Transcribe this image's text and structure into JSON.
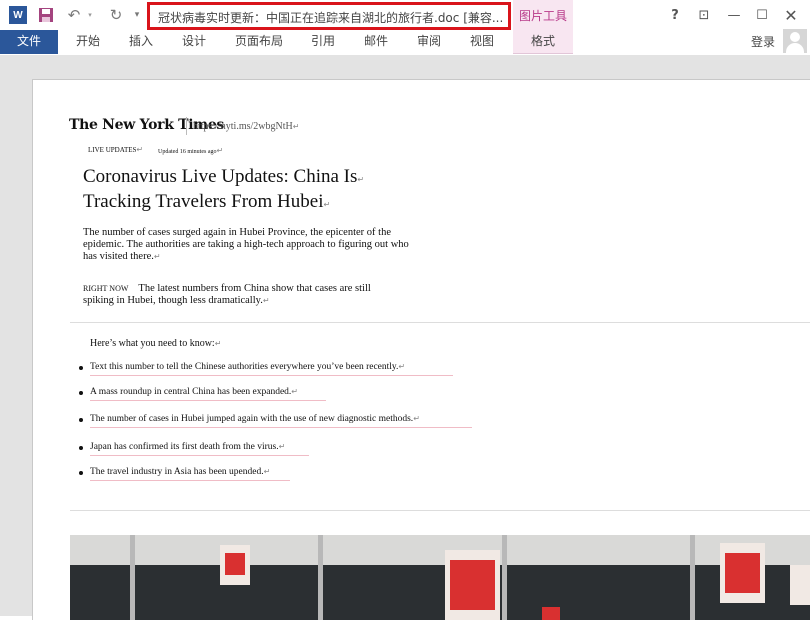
{
  "app": {
    "doc_title": "冠状病毒实时更新：中国正在追踪来自湖北的旅行者.doc [兼容...",
    "contextual_group": "图片工具",
    "word_icon_letter": "W",
    "login": "登录",
    "window_buttons": {
      "help": "?",
      "ribbon_options": "⊡",
      "minimize": "—",
      "maximize": "☐",
      "close": "✕"
    },
    "icons": [
      "word-icon",
      "save-icon",
      "undo-icon",
      "redo-icon",
      "customize-qat-icon",
      "avatar"
    ]
  },
  "ribbon": {
    "tabs": [
      {
        "label": "文件"
      },
      {
        "label": "开始"
      },
      {
        "label": "插入"
      },
      {
        "label": "设计"
      },
      {
        "label": "页面布局"
      },
      {
        "label": "引用"
      },
      {
        "label": "邮件"
      },
      {
        "label": "审阅"
      },
      {
        "label": "视图"
      },
      {
        "label": "格式"
      }
    ]
  },
  "document": {
    "masthead": "The New York Times",
    "short_link": "https://nyti.ms/2wbgNtH",
    "live_updates": "LIVE UPDATES",
    "updated": "Updated 16 minutes ago",
    "headline_line1": "Coronavirus Live Updates: China Is",
    "headline_line2": "Tracking Travelers From Hubei",
    "summary": "The number of cases surged again in Hubei Province, the epicenter of the epidemic. The authorities are taking a high-tech approach to figuring out who has visited there.",
    "right_now_label": "RIGHT NOW",
    "right_now_text": "The latest numbers from China show that cases are still spiking in Hubei, though less dramatically.",
    "intro": "Here’s what you need to know:",
    "bullets": [
      "Text this number to tell the Chinese authorities everywhere you’ve been recently.",
      "A mass roundup in central China has been expanded.",
      "The number of cases in Hubei jumped again with the use of new diagnostic methods.",
      "Japan has confirmed its first death from the virus.",
      "The travel industry in Asia has been upended."
    ],
    "paragraph_mark": "↵",
    "highlight_color": "#d9141b",
    "accent_color": "#2b579a"
  }
}
